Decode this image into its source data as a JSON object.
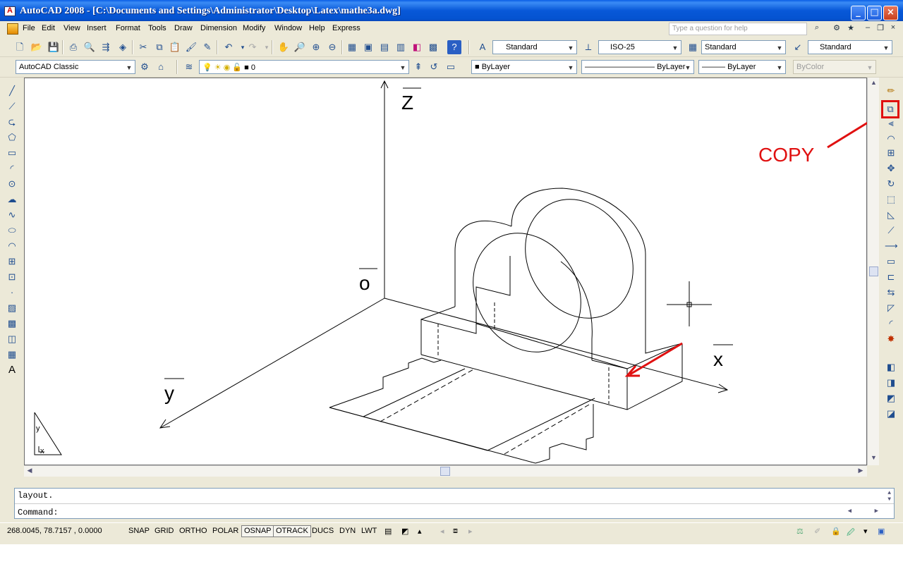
{
  "window": {
    "title": "AutoCAD 2008 - [C:\\Documents and Settings\\Administrator\\Desktop\\Latex\\mathe3a.dwg]"
  },
  "menu": {
    "items": [
      "File",
      "Edit",
      "View",
      "Insert",
      "Format",
      "Tools",
      "Draw",
      "Dimension",
      "Modify",
      "Window",
      "Help",
      "Express"
    ]
  },
  "help_search": {
    "placeholder": "Type a question for help"
  },
  "toolbar_styles": {
    "text_style": "Standard",
    "dim_style": "ISO-25",
    "table_style": "Standard",
    "mleader_style": "Standard"
  },
  "workspace": {
    "name": "AutoCAD Classic"
  },
  "layer": {
    "current": "0"
  },
  "properties": {
    "color": "ByLayer",
    "linetype": "ByLayer",
    "lineweight": "ByLayer",
    "plotstyle": "ByColor"
  },
  "drawing": {
    "axis_labels": {
      "z": "Z",
      "o": "o",
      "y": "y",
      "x": "x"
    },
    "annotation": {
      "text": "COPY",
      "color": "#e01010"
    }
  },
  "command_line": {
    "history": "layout.",
    "prompt": "Command:"
  },
  "status": {
    "coordinates": "268.0045,  78.7157 , 0.0000",
    "toggles": [
      {
        "label": "SNAP",
        "on": false
      },
      {
        "label": "GRID",
        "on": false
      },
      {
        "label": "ORTHO",
        "on": false
      },
      {
        "label": "POLAR",
        "on": false
      },
      {
        "label": "OSNAP",
        "on": true
      },
      {
        "label": "OTRACK",
        "on": true
      },
      {
        "label": "DUCS",
        "on": false
      },
      {
        "label": "DYN",
        "on": false
      },
      {
        "label": "LWT",
        "on": false
      }
    ]
  },
  "icons": {
    "left_palette": [
      "line-icon",
      "construction-line-icon",
      "polyline-icon",
      "polygon-icon",
      "rectangle-icon",
      "arc-icon",
      "circle-icon",
      "revision-cloud-icon",
      "spline-icon",
      "ellipse-icon",
      "ellipse-arc-icon",
      "insert-block-icon",
      "make-block-icon",
      "point-icon",
      "hatch-icon",
      "gradient-icon",
      "region-icon",
      "table-icon",
      "multiline-text-icon"
    ],
    "right_palette": [
      "erase-icon",
      "copy-icon",
      "mirror-icon",
      "offset-icon",
      "array-icon",
      "move-icon",
      "rotate-icon",
      "scale-icon",
      "stretch-icon",
      "trim-icon",
      "extend-icon",
      "break-at-point-icon",
      "break-icon",
      "join-icon",
      "chamfer-icon",
      "fillet-icon",
      "explode-icon"
    ]
  }
}
